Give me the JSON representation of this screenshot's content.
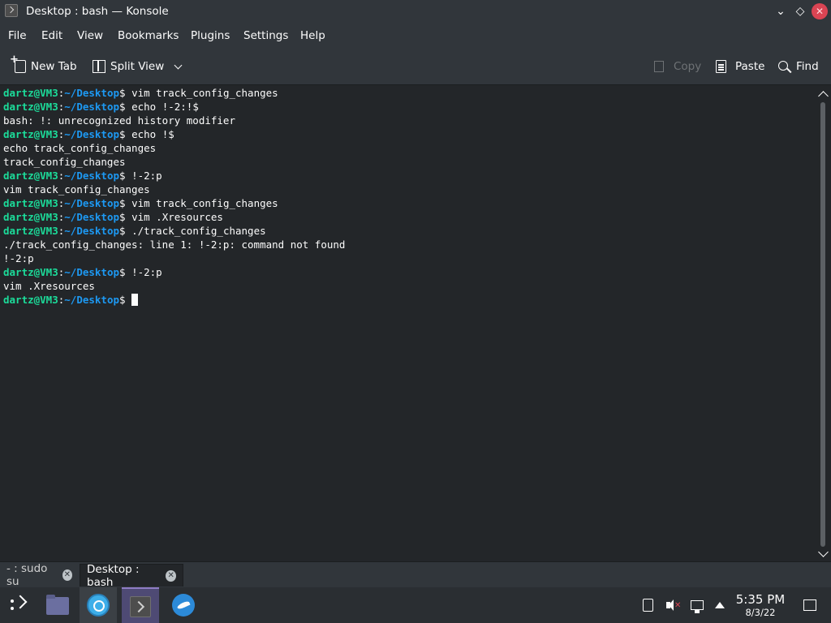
{
  "window": {
    "title": "Desktop : bash — Konsole",
    "controls": {
      "minimize": "⌄",
      "maximize": "◇",
      "close": "✕"
    }
  },
  "menu": [
    "File",
    "Edit",
    "View",
    "Bookmarks",
    "Plugins",
    "Settings",
    "Help"
  ],
  "toolbar": {
    "new_tab": "New Tab",
    "split_view": "Split View",
    "copy": "Copy",
    "paste": "Paste",
    "find": "Find"
  },
  "terminal": {
    "prompt_user": "dartz@VM3",
    "prompt_sep": ":",
    "prompt_path": "~/Desktop",
    "prompt_end": "$ ",
    "lines": [
      {
        "type": "prompt",
        "text": "vim track_config_changes"
      },
      {
        "type": "prompt",
        "text": "echo !-2:!$"
      },
      {
        "type": "output",
        "text": "bash: !: unrecognized history modifier"
      },
      {
        "type": "prompt",
        "text": "echo !$"
      },
      {
        "type": "output",
        "text": "echo track_config_changes"
      },
      {
        "type": "output",
        "text": "track_config_changes"
      },
      {
        "type": "prompt",
        "text": "!-2:p"
      },
      {
        "type": "output",
        "text": "vim track_config_changes"
      },
      {
        "type": "prompt",
        "text": "vim track_config_changes"
      },
      {
        "type": "prompt",
        "text": "vim .Xresources"
      },
      {
        "type": "prompt",
        "text": "./track_config_changes"
      },
      {
        "type": "output",
        "text": "./track_config_changes: line 1: !-2:p: command not found"
      },
      {
        "type": "output",
        "text": "!-2:p"
      },
      {
        "type": "prompt",
        "text": "!-2:p"
      },
      {
        "type": "output",
        "text": "vim .Xresources"
      },
      {
        "type": "prompt_cursor",
        "text": ""
      }
    ]
  },
  "tabs": [
    {
      "label": "- : sudo su",
      "active": false
    },
    {
      "label": "Desktop : bash",
      "active": true
    }
  ],
  "taskbar": {
    "apps": [
      "application-launcher-icon",
      "folder-icon",
      "browser-icon",
      "konsole-icon",
      "bird-icon"
    ],
    "clock_time": "5:35 PM",
    "clock_date": "8/3/22"
  },
  "colors": {
    "prompt_user": "#1cdc9a",
    "prompt_path": "#1d99f3",
    "background": "#232629",
    "chrome": "#31363b",
    "close_button": "#da4453"
  }
}
